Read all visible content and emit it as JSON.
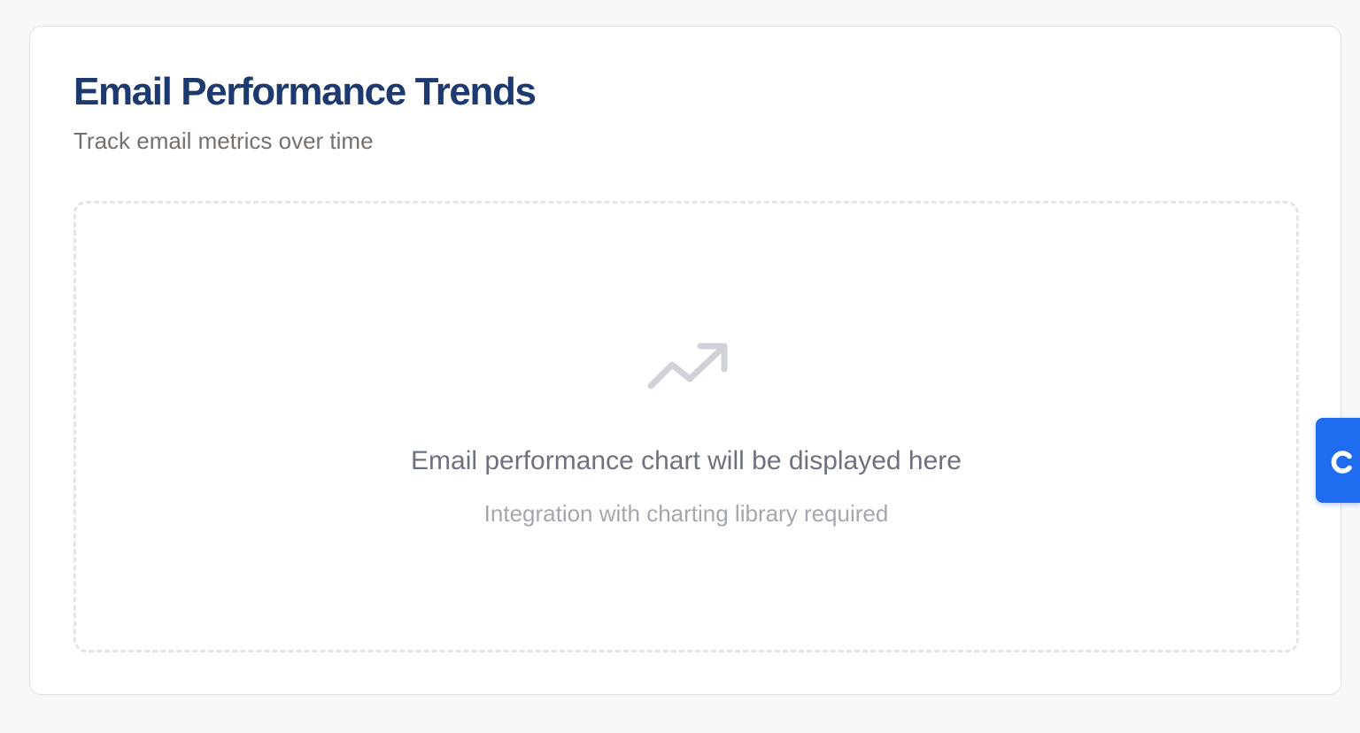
{
  "card": {
    "title": "Email Performance Trends",
    "subtitle": "Track email metrics over time"
  },
  "chart_placeholder": {
    "icon": "trending-up-icon",
    "message": "Email performance chart will be displayed here",
    "note": "Integration with charting library required"
  },
  "side_tab": {
    "icon": "c-logo-icon",
    "color": "#1f6cf0"
  },
  "colors": {
    "page_background": "#f7f8fa",
    "title": "#1c3a70",
    "subtitle": "#77706b",
    "icon": "#cfd3d9"
  }
}
